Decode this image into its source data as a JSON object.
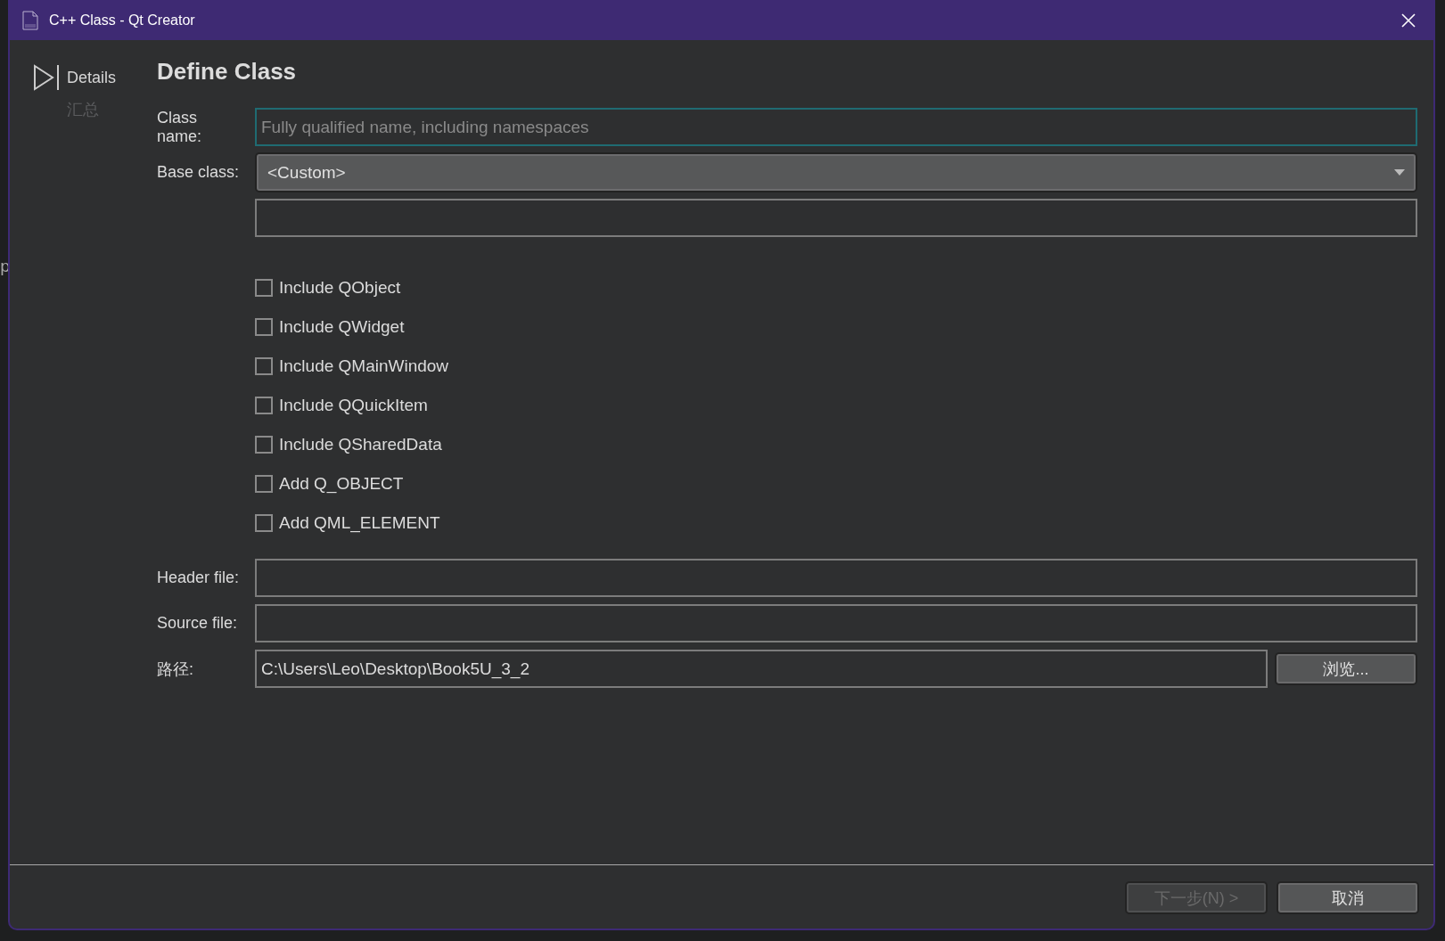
{
  "background_window": {
    "text_fragment": "p"
  },
  "window": {
    "title": "C++ Class - Qt Creator"
  },
  "sidebar": {
    "items": [
      {
        "label": "Details",
        "selected": true
      },
      {
        "label": "汇总",
        "selected": false
      }
    ]
  },
  "page": {
    "title": "Define Class",
    "class_name": {
      "label": "Class name:",
      "placeholder": "Fully qualified name, including namespaces"
    },
    "base_class": {
      "label": "Base class:",
      "value": "<Custom>"
    },
    "options": [
      {
        "label": "Include QObject",
        "checked": false
      },
      {
        "label": "Include QWidget",
        "checked": false
      },
      {
        "label": "Include QMainWindow",
        "checked": false
      },
      {
        "label": "Include QQuickItem",
        "checked": false
      },
      {
        "label": "Include QSharedData",
        "checked": false
      },
      {
        "label": "Add Q_OBJECT",
        "checked": false
      },
      {
        "label": "Add QML_ELEMENT",
        "checked": false
      }
    ],
    "header_file": {
      "label": "Header file:"
    },
    "source_file": {
      "label": "Source file:"
    },
    "path": {
      "label": "路径:",
      "value": "C:\\Users\\Leo\\Desktop\\Book5U_3_2",
      "browse": "浏览..."
    }
  },
  "buttons": [
    {
      "label": "下一步(N) >",
      "disabled": true
    },
    {
      "label": "取消",
      "disabled": false
    }
  ]
}
